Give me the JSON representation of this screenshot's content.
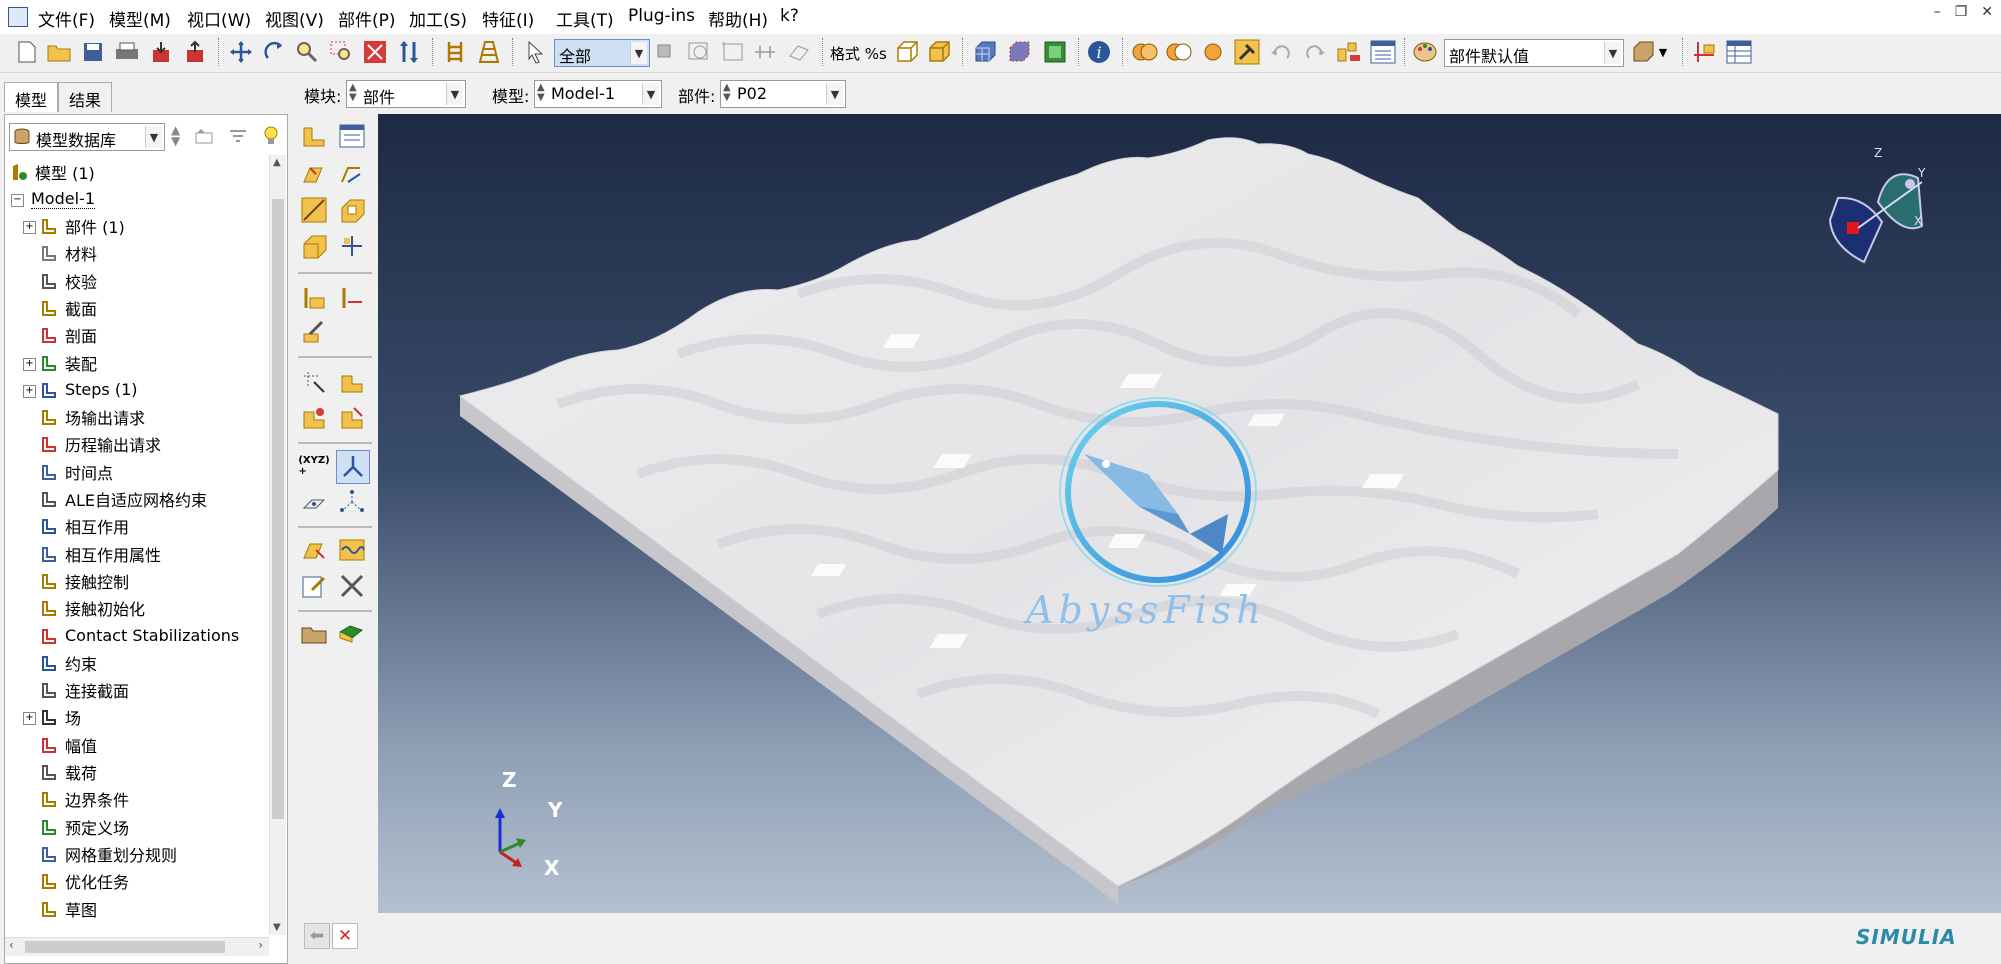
{
  "menu": [
    "文件(F)",
    "模型(M)",
    "视口(W)",
    "视图(V)",
    "部件(P)",
    "加工(S)",
    "特征(I)",
    "工具(T)",
    "Plug-ins",
    "帮助(H)",
    "k?"
  ],
  "toolbar": {
    "select_filter": "全部",
    "format_label": "格式 %s",
    "render_style": "部件默认值"
  },
  "context": {
    "module_label": "模块:",
    "module_value": "部件",
    "model_label": "模型:",
    "model_value": "Model-1",
    "part_label": "部件:",
    "part_value": "P02"
  },
  "tabs": [
    "模型",
    "结果"
  ],
  "tree_combo": "模型数据库",
  "tree": {
    "root": "模型 (1)",
    "model": "Model-1",
    "items": [
      "部件 (1)",
      "材料",
      "校验",
      "截面",
      "剖面",
      "装配",
      "Steps (1)",
      "场输出请求",
      "历程输出请求",
      "时间点",
      "ALE自适应网格约束",
      "相互作用",
      "相互作用属性",
      "接触控制",
      "接触初始化",
      "Contact Stabilizations",
      "约束",
      "连接截面",
      "场",
      "幅值",
      "载荷",
      "边界条件",
      "预定义场",
      "网格重划分规则",
      "优化任务",
      "草图"
    ]
  },
  "viewport": {
    "triad": {
      "x": "X",
      "y": "Y",
      "z": "Z"
    },
    "watermark": "AbyssFish",
    "brand": "SIMULIA"
  },
  "colors": {
    "accent": "#2b579a",
    "viewport_top": "#1d2a44",
    "viewport_bottom": "#b4c0cf",
    "surface": "#e8e8ea"
  }
}
